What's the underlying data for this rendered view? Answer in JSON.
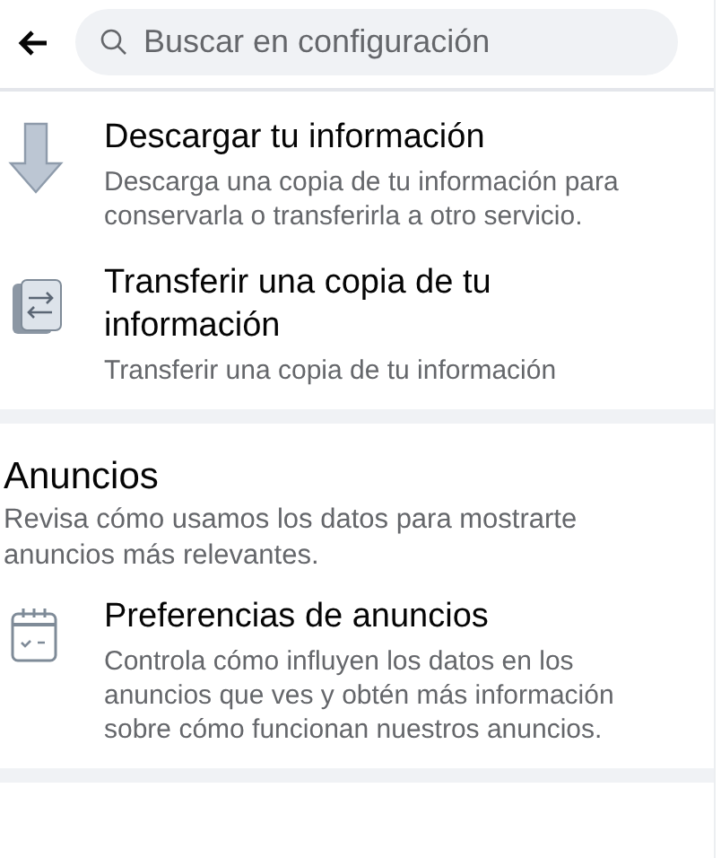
{
  "search": {
    "placeholder": "Buscar en configuración"
  },
  "sections": [
    {
      "items": [
        {
          "kind": "download",
          "title": "Descargar tu información",
          "description": "Descarga una copia de tu información para conservarla o transferirla a otro servicio."
        },
        {
          "kind": "transfer",
          "title": "Transferir una copia de tu información",
          "description": "Transferir una copia de tu información"
        }
      ]
    },
    {
      "heading": "Anuncios",
      "description": "Revisa cómo usamos los datos para mostrarte anuncios más relevantes.",
      "items": [
        {
          "kind": "calendar",
          "title": "Preferencias de anuncios",
          "description": "Controla cómo influyen los datos en los anuncios que ves y obtén más información sobre cómo funcionan nuestros anuncios."
        }
      ]
    }
  ]
}
